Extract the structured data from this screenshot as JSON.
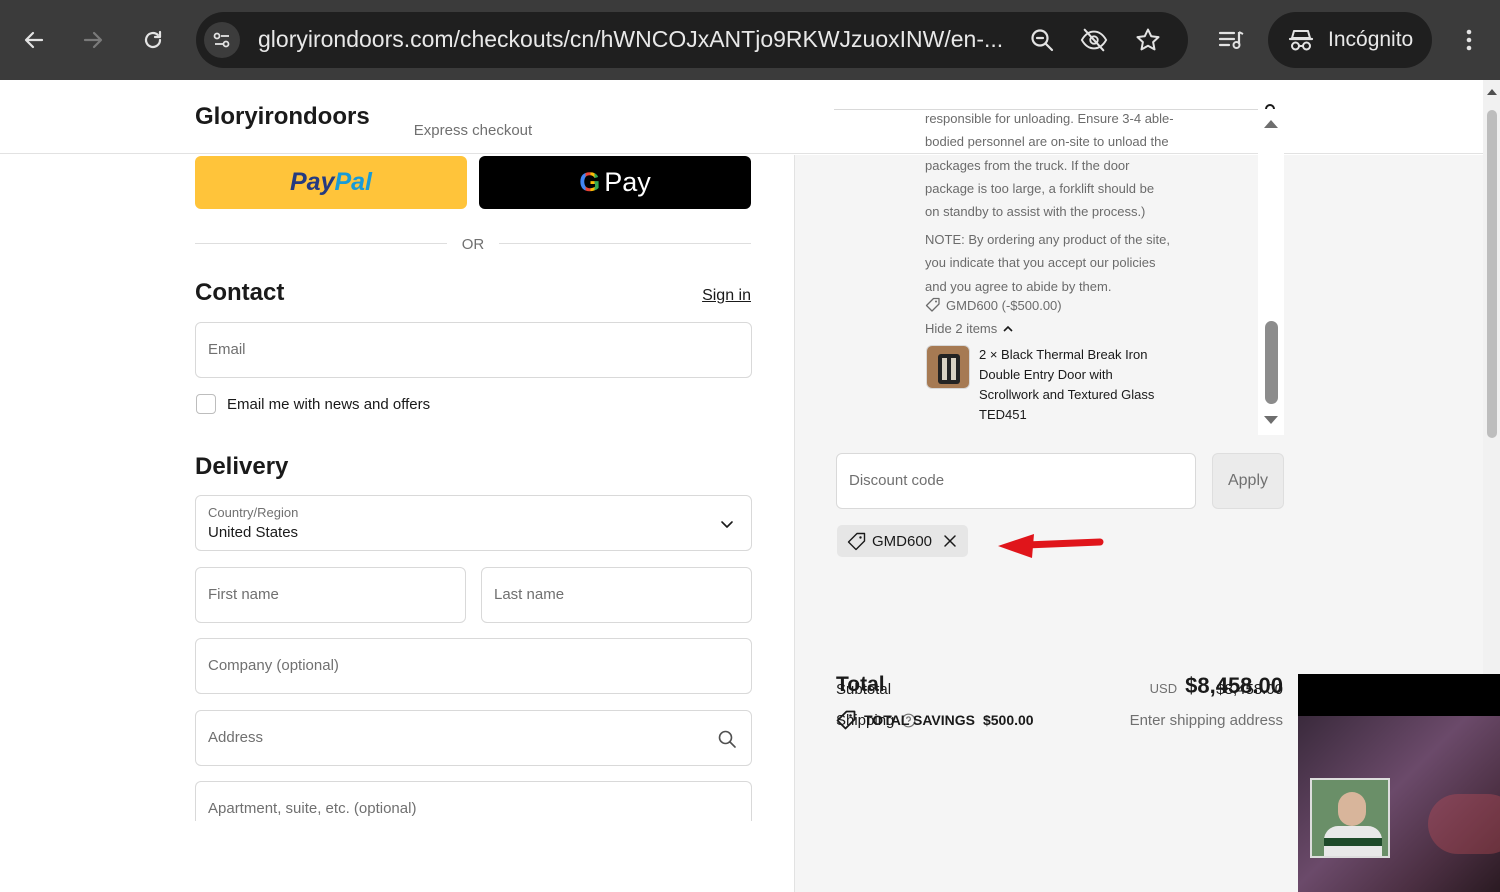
{
  "browser": {
    "url": "gloryirondoors.com/checkouts/cn/hWNCOJxANTjo9RKWJzuoxINW/en-...",
    "incognito_label": "Incógnito"
  },
  "store": {
    "brand": "Gloryirondoors"
  },
  "express": {
    "label": "Express checkout",
    "paypal_pay": "Pay",
    "paypal_pal": "Pal",
    "gpay_g": "G",
    "gpay_label": "Pay",
    "or_label": "OR"
  },
  "contact": {
    "title": "Contact",
    "sign_in": "Sign in",
    "email_placeholder": "Email",
    "newsletter_label": "Email me with news and offers"
  },
  "delivery": {
    "title": "Delivery",
    "country_label": "Country/Region",
    "country_value": "United States",
    "first_name_placeholder": "First name",
    "last_name_placeholder": "Last name",
    "company_placeholder": "Company (optional)",
    "address_placeholder": "Address",
    "apartment_placeholder": "Apartment, suite, etc. (optional)"
  },
  "summary": {
    "note_lines": [
      "responsible for unloading. Ensure 3-4 able-",
      "bodied personnel are on-site to unload the",
      "packages from the truck. If the door",
      "package is too large, a forklift should be",
      "on standby to assist with the process.)"
    ],
    "policy_lines": [
      "NOTE: By ordering any product of the site,",
      "you indicate that you accept our policies",
      "and you agree to abide by them."
    ],
    "line_discount": "GMD600 (-$500.00)",
    "hide_items": "Hide 2 items",
    "item_lines": [
      "2 × Black Thermal Break Iron",
      "Double Entry Door with",
      "Scrollwork and Textured Glass",
      "TED451"
    ],
    "discount_placeholder": "Discount code",
    "apply_label": "Apply",
    "applied_code": "GMD600",
    "subtotal_label": "Subtotal",
    "subtotal_value": "$8,458.00",
    "shipping_label": "Shipping",
    "shipping_value": "Enter shipping address",
    "total_label": "Total",
    "total_currency": "USD",
    "total_value": "$8,458.00",
    "savings_label": "TOTAL SAVINGS",
    "savings_value": "$500.00"
  },
  "colors": {
    "paypal_bg": "#ffc43a",
    "paypal_dark": "#253b80",
    "paypal_light": "#179bd7",
    "annotation_arrow": "#e0151b"
  }
}
